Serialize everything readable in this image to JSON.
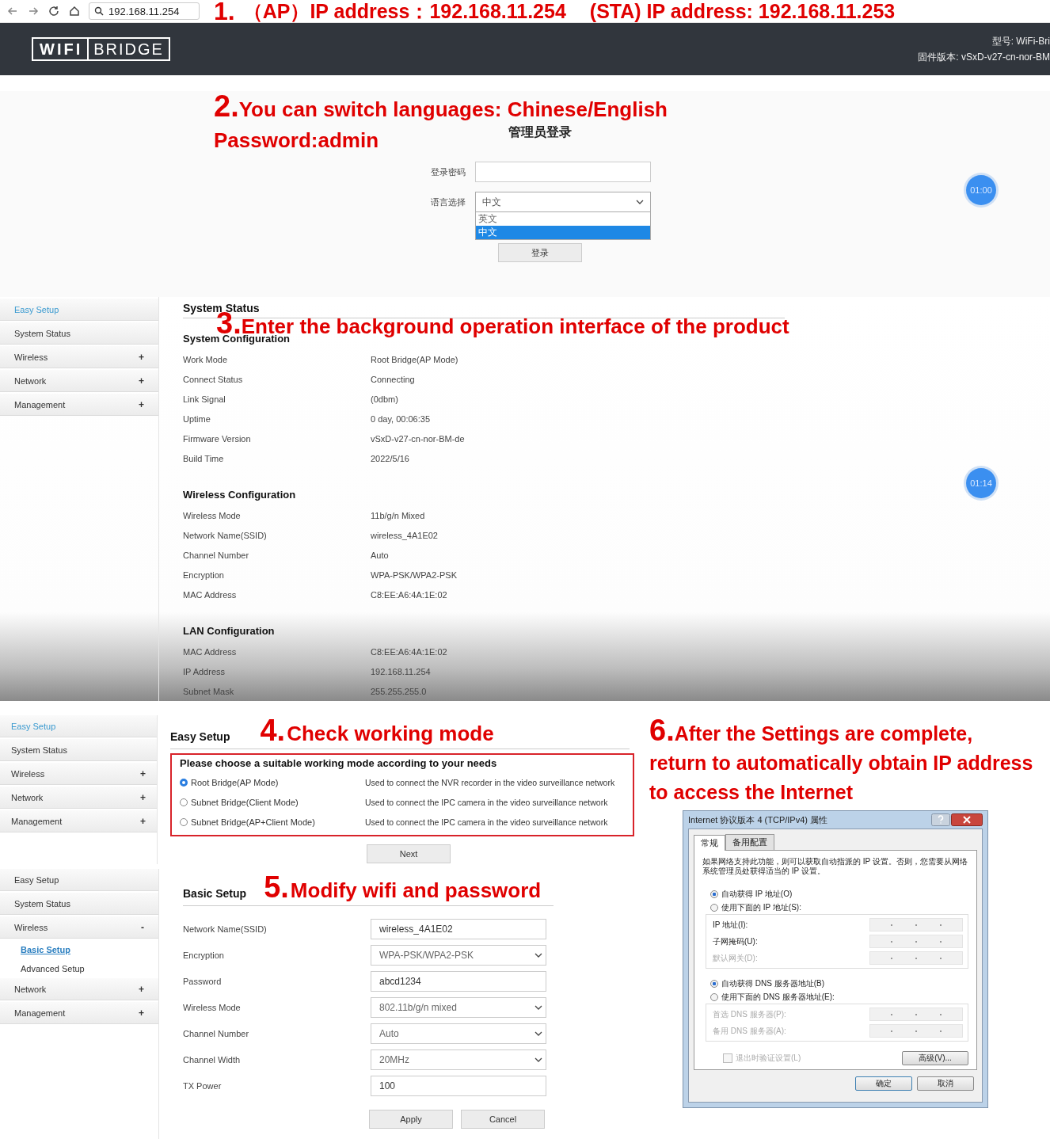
{
  "browser": {
    "url": "192.168.11.254",
    "step_number": "1.",
    "ap_text": "（AP）IP address：192.168.11.254",
    "sta_text": "(STA) IP address: 192.168.11.253"
  },
  "header": {
    "logo_left": "WIFI",
    "logo_right": "BRIDGE",
    "model": "型号: WiFi-Bri",
    "firmware": "固件版本: vSxD-v27-cn-nor-BM"
  },
  "login": {
    "step_number": "2.",
    "step_text": "You can switch languages: Chinese/English",
    "password_note": "Password:admin",
    "title": "管理员登录",
    "password_label": "登录密码",
    "language_label": "语言选择",
    "language_value": "中文",
    "options": [
      {
        "label": "英文",
        "selected": false
      },
      {
        "label": "中文",
        "selected": true
      }
    ],
    "button": "登录",
    "timer": "01:00"
  },
  "status": {
    "sidebar": [
      {
        "label": "Easy Setup",
        "selected": true
      },
      {
        "label": "System Status",
        "selected": false
      },
      {
        "label": "Wireless",
        "selected": false,
        "toggle": "+"
      },
      {
        "label": "Network",
        "selected": false,
        "toggle": "+"
      },
      {
        "label": "Management",
        "selected": false,
        "toggle": "+"
      }
    ],
    "title": "System Status",
    "step_number": "3.",
    "step_text": "Enter the background operation interface of the product",
    "timer": "01:14",
    "sections": [
      {
        "title": "System Configuration",
        "rows": [
          {
            "label": "Work Mode",
            "value": "Root Bridge(AP Mode)"
          },
          {
            "label": "Connect Status",
            "value": "Connecting"
          },
          {
            "label": "Link Signal",
            "value": "(0dbm)"
          },
          {
            "label": "Uptime",
            "value": "0 day, 00:06:35"
          },
          {
            "label": "Firmware Version",
            "value": "vSxD-v27-cn-nor-BM-de"
          },
          {
            "label": "Build Time",
            "value": "2022/5/16"
          }
        ]
      },
      {
        "title": "Wireless Configuration",
        "rows": [
          {
            "label": "Wireless Mode",
            "value": "11b/g/n Mixed"
          },
          {
            "label": "Network Name(SSID)",
            "value": "wireless_4A1E02"
          },
          {
            "label": "Channel Number",
            "value": "Auto"
          },
          {
            "label": "Encryption",
            "value": "WPA-PSK/WPA2-PSK"
          },
          {
            "label": "MAC Address",
            "value": "C8:EE:A6:4A:1E:02"
          }
        ]
      },
      {
        "title": "LAN Configuration",
        "rows": [
          {
            "label": "MAC Address",
            "value": "C8:EE:A6:4A:1E:02"
          },
          {
            "label": "IP Address",
            "value": "192.168.11.254"
          },
          {
            "label": "Subnet Mask",
            "value": "255.255.255.0"
          }
        ]
      }
    ]
  },
  "easy_setup": {
    "sidebar": [
      {
        "label": "Easy Setup",
        "selected": true
      },
      {
        "label": "System Status",
        "selected": false
      },
      {
        "label": "Wireless",
        "selected": false,
        "toggle": "+"
      },
      {
        "label": "Network",
        "selected": false,
        "toggle": "+"
      },
      {
        "label": "Management",
        "selected": false,
        "toggle": "+"
      }
    ],
    "title": "Easy Setup",
    "step_number": "4.",
    "step_text": "Check working mode",
    "prompt": "Please choose a suitable working mode according to your needs",
    "modes": [
      {
        "label": "Root Bridge(AP Mode)",
        "description": "Used to connect the NVR recorder in the video surveillance network",
        "selected": true
      },
      {
        "label": "Subnet Bridge(Client Mode)",
        "description": "Used to connect the IPC camera in the video surveillance network",
        "selected": false
      },
      {
        "label": "Subnet Bridge(AP+Client Mode)",
        "description": "Used to connect the IPC camera in the video surveillance network",
        "selected": false
      }
    ],
    "button": "Next"
  },
  "basic_setup": {
    "sidebar": [
      {
        "label": "Easy Setup",
        "selected": false
      },
      {
        "label": "System Status",
        "selected": false
      },
      {
        "label": "Wireless",
        "selected": false,
        "toggle": "-",
        "children": [
          {
            "label": "Basic Setup",
            "selected": true
          },
          {
            "label": "Advanced Setup",
            "selected": false
          }
        ]
      },
      {
        "label": "Network",
        "selected": false,
        "toggle": "+"
      },
      {
        "label": "Management",
        "selected": false,
        "toggle": "+"
      }
    ],
    "title": "Basic Setup",
    "step_number": "5.",
    "step_text": "Modify wifi and password",
    "fields": [
      {
        "label": "Network Name(SSID)",
        "value": "wireless_4A1E02",
        "kind": "text"
      },
      {
        "label": "Encryption",
        "value": "WPA-PSK/WPA2-PSK",
        "kind": "select"
      },
      {
        "label": "Password",
        "value": "abcd1234",
        "kind": "text"
      },
      {
        "label": "Wireless Mode",
        "value": "802.11b/g/n mixed",
        "kind": "select"
      },
      {
        "label": "Channel Number",
        "value": "Auto",
        "kind": "select"
      },
      {
        "label": "Channel Width",
        "value": "20MHz",
        "kind": "select"
      },
      {
        "label": "TX Power",
        "value": "100",
        "kind": "text"
      }
    ],
    "buttons": [
      "Apply",
      "Cancel"
    ]
  },
  "finish": {
    "step_number": "6.",
    "lines": [
      "After the Settings are complete,",
      "return to automatically obtain IP address",
      "to access the Internet"
    ]
  },
  "dialog": {
    "title": "Internet 协议版本 4 (TCP/IPv4) 属性",
    "tabs": [
      {
        "label": "常规",
        "selected": true
      },
      {
        "label": "备用配置",
        "selected": false
      }
    ],
    "description": "如果网络支持此功能，则可以获取自动指派的 IP 设置。否则，您需要从网络系统管理员处获得适当的 IP 设置。",
    "ip_options": [
      {
        "label": "自动获得 IP 地址(O)",
        "selected": true
      },
      {
        "label": "使用下面的 IP 地址(S):",
        "selected": false
      }
    ],
    "ip_fields": [
      {
        "label": "IP 地址(I):",
        "disabled": false
      },
      {
        "label": "子网掩码(U):",
        "disabled": false
      },
      {
        "label": "默认网关(D):",
        "disabled": true
      }
    ],
    "dns_options": [
      {
        "label": "自动获得 DNS 服务器地址(B)",
        "selected": true
      },
      {
        "label": "使用下面的 DNS 服务器地址(E):",
        "selected": false
      }
    ],
    "dns_fields": [
      {
        "label": "首选 DNS 服务器(P):",
        "disabled": true
      },
      {
        "label": "备用 DNS 服务器(A):",
        "disabled": true
      }
    ],
    "validate": {
      "label": "退出时验证设置(L)",
      "checked": false,
      "disabled": true
    },
    "advanced": "高级(V)...",
    "ok": "确定",
    "cancel": "取消"
  }
}
